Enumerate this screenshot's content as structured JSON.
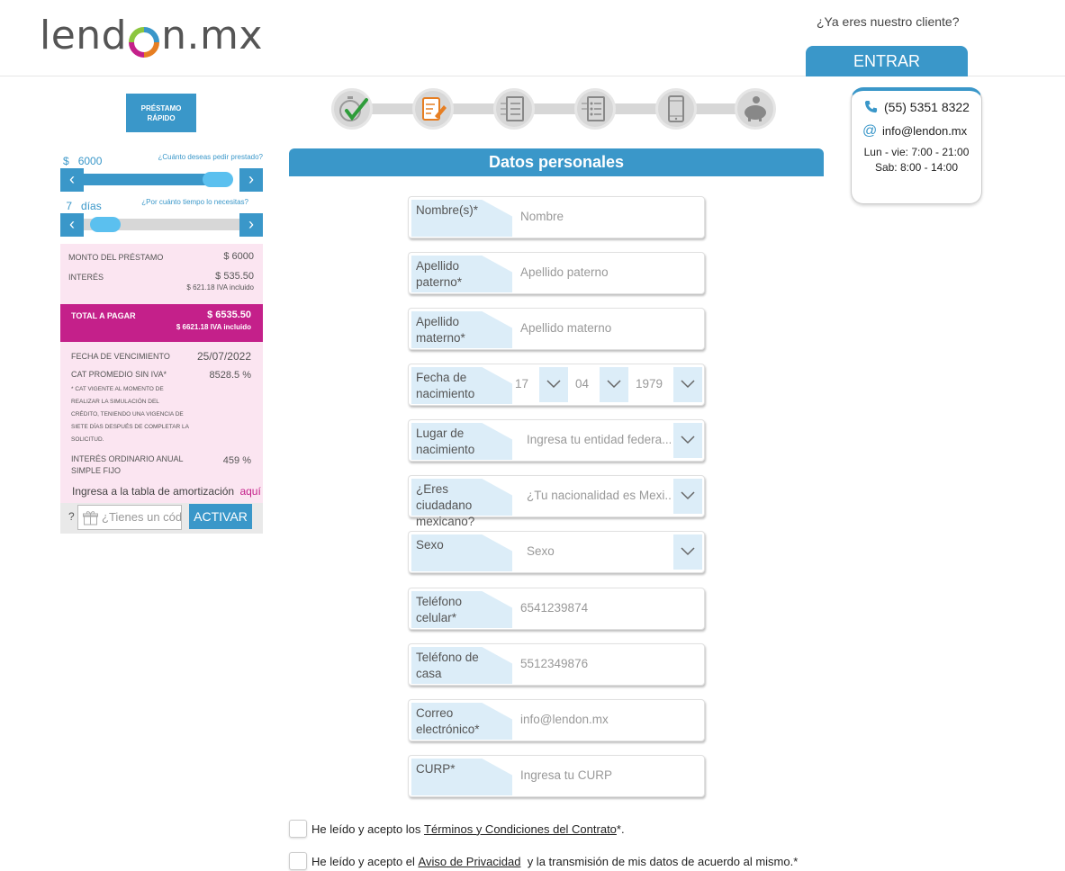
{
  "header": {
    "logo_text_left": "lend",
    "logo_text_right": "n.mx",
    "client_question": "¿Ya eres nuestro cliente?",
    "login_button": "ENTRAR"
  },
  "sidebar": {
    "quick_loan_line1": "PRÉSTAMO",
    "quick_loan_line2": "RÁPIDO",
    "amount_slider": {
      "currency": "$",
      "value": "6000",
      "question": "¿Cuánto deseas pedir prestado?",
      "fraction": 0.95
    },
    "days_slider": {
      "value": "7",
      "unit": "días",
      "question": "¿Por cuánto tiempo lo necesitas?",
      "fraction": 0.05
    },
    "summary": {
      "amount_label": "MONTO DEL PRÉSTAMO",
      "amount_value": "$ 6000",
      "interest_label": "INTERÉS",
      "interest_value": "$ 535.50",
      "interest_sub": "$ 621.18 IVA incluido",
      "total_label": "TOTAL A PAGAR",
      "total_value": "$ 6535.50",
      "total_sub": "$ 6621.18 IVA incluido",
      "due_label": "FECHA DE VENCIMIENTO",
      "due_value": "25/07/2022",
      "cat_label": "CAT PROMEDIO SIN IVA*",
      "cat_value": "8528.5 %",
      "cat_note_1": "* CAT VIGENTE AL MOMENTO DE",
      "cat_note_2": "REALIZAR LA SIMULACIÓN DEL",
      "cat_note_3": "CRÉDITO, TENIENDO UNA VIGENCIA DE",
      "cat_note_4": "SIETE DÍAS DESPUÉS DE COMPLETAR LA",
      "cat_note_5": "SOLICITUD.",
      "annual_label_1": "INTERÉS ORDINARIO ANUAL",
      "annual_label_2": "SIMPLE FIJO",
      "annual_value": "459 %",
      "amortization_text": "Ingresa a la tabla de amortización",
      "amortization_link": "aquí"
    },
    "promo": {
      "help": "?",
      "placeholder": "¿Tienes un código?",
      "button": "ACTIVAR"
    }
  },
  "steps": {
    "icons": [
      "stopwatch-check-icon",
      "form-edit-icon",
      "checklist-icon",
      "checklist-icon",
      "smartphone-icon",
      "piggy-bank-icon"
    ],
    "active_index": 1
  },
  "form": {
    "title": "Datos personales",
    "fields": {
      "nombre": {
        "label_1": "Nombre(s)*",
        "label_2": "",
        "placeholder": "Nombre"
      },
      "apellido_paterno": {
        "label_1": "Apellido",
        "label_2": "paterno*",
        "placeholder": "Apellido paterno"
      },
      "apellido_materno": {
        "label_1": "Apellido",
        "label_2": "materno*",
        "placeholder": "Apellido materno"
      },
      "fecha": {
        "label_1": "Fecha de",
        "label_2": "nacimiento",
        "day": "17",
        "month": "04",
        "year": "1979"
      },
      "lugar": {
        "label_1": "Lugar de",
        "label_2": "nacimiento",
        "placeholder": "Ingresa tu entidad federa..."
      },
      "ciudadano": {
        "label_1": "¿Eres",
        "label_2": "ciudadano",
        "label_3": "mexicano?",
        "placeholder": "¿Tu nacionalidad es Mexi..."
      },
      "sexo": {
        "label_1": "Sexo",
        "label_2": "",
        "placeholder": "Sexo"
      },
      "tel_celular": {
        "label_1": "Teléfono",
        "label_2": "celular*",
        "placeholder": "6541239874"
      },
      "tel_casa": {
        "label_1": "Teléfono de",
        "label_2": "casa",
        "placeholder": "5512349876"
      },
      "correo": {
        "label_1": "Correo",
        "label_2": "electrónico*",
        "placeholder": "info@lendon.mx"
      },
      "curp": {
        "label_1": "CURP*",
        "label_2": "",
        "placeholder": "Ingresa tu CURP"
      }
    },
    "terms": {
      "text_before": "He leído y acepto los ",
      "link": "Términos y Condiciones del Contrato",
      "text_after": "*."
    },
    "privacy": {
      "text_before": "He leído y acepto el ",
      "link": "Aviso de Privacidad",
      "text_after": "  y la transmisión de mis datos de acuerdo al mismo.*"
    }
  },
  "contact": {
    "phone": "(55) 5351 8322",
    "email": "info@lendon.mx",
    "hours_weekday": "Lun - vie: 7:00 - 21:00",
    "hours_saturday": "Sab: 8:00 - 14:00"
  },
  "colors": {
    "primary": "#3a97c9",
    "accent": "#c4208a",
    "summary_bg": "#fbe5f1",
    "label_bg": "#dcedf8"
  }
}
